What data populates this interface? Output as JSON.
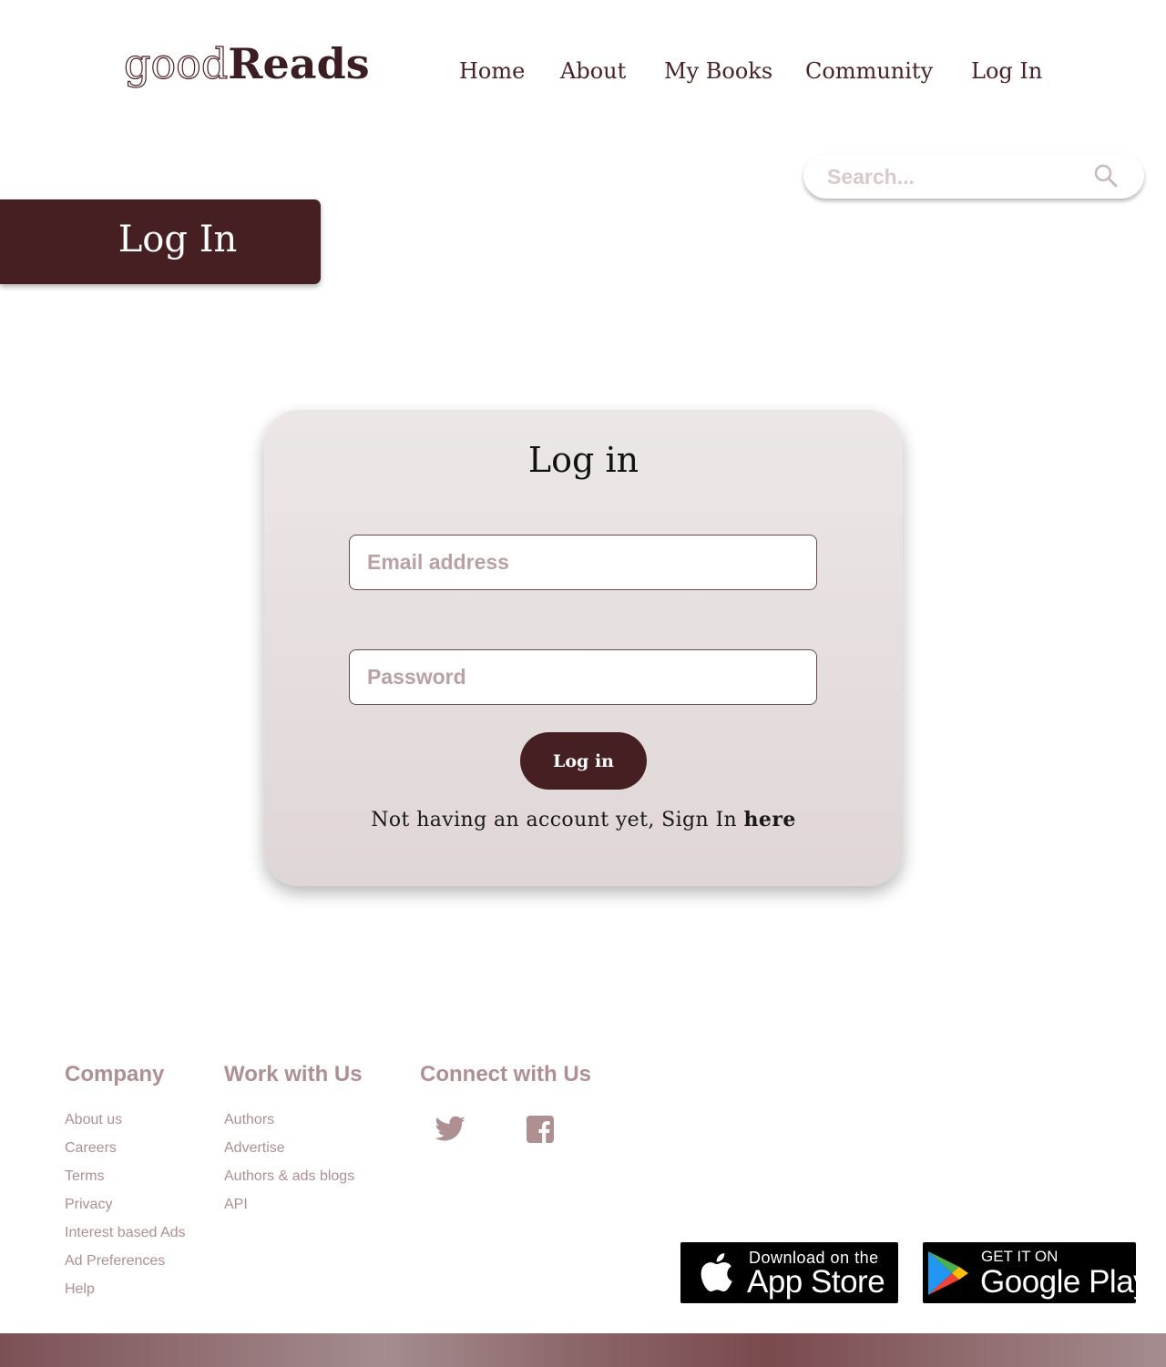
{
  "brand": {
    "logo_light": "good",
    "logo_bold": "Reads"
  },
  "nav": {
    "items": [
      "Home",
      "About",
      "My Books",
      "Community",
      "Log In"
    ]
  },
  "search": {
    "placeholder": "Search...",
    "icon": "search-icon"
  },
  "page_title": "Log In",
  "login_card": {
    "title": "Log in",
    "email_placeholder": "Email address",
    "password_placeholder": "Password",
    "submit_label": "Log in",
    "signup_text": "Not having an account yet, Sign In ",
    "signup_link": "here"
  },
  "footer": {
    "company": {
      "heading": "Company",
      "links": [
        "About us",
        "Careers",
        "Terms",
        "Privacy",
        "Interest based Ads",
        "Ad Preferences",
        "Help"
      ]
    },
    "work": {
      "heading": "Work with Us",
      "links": [
        "Authors",
        "Advertise",
        "Authors & ads blogs",
        "API"
      ]
    },
    "connect": {
      "heading": "Connect with Us",
      "icons": [
        "twitter-icon",
        "facebook-icon"
      ]
    },
    "app_store": {
      "line1": "Download on the",
      "line2": "App Store"
    },
    "google_play": {
      "line1": "GET IT ON",
      "line2": "Google Play"
    }
  },
  "colors": {
    "brand_dark": "#461f22",
    "footer_text": "#ae9093",
    "card_top": "#ece7e7",
    "card_bottom": "#e0d6d7"
  }
}
